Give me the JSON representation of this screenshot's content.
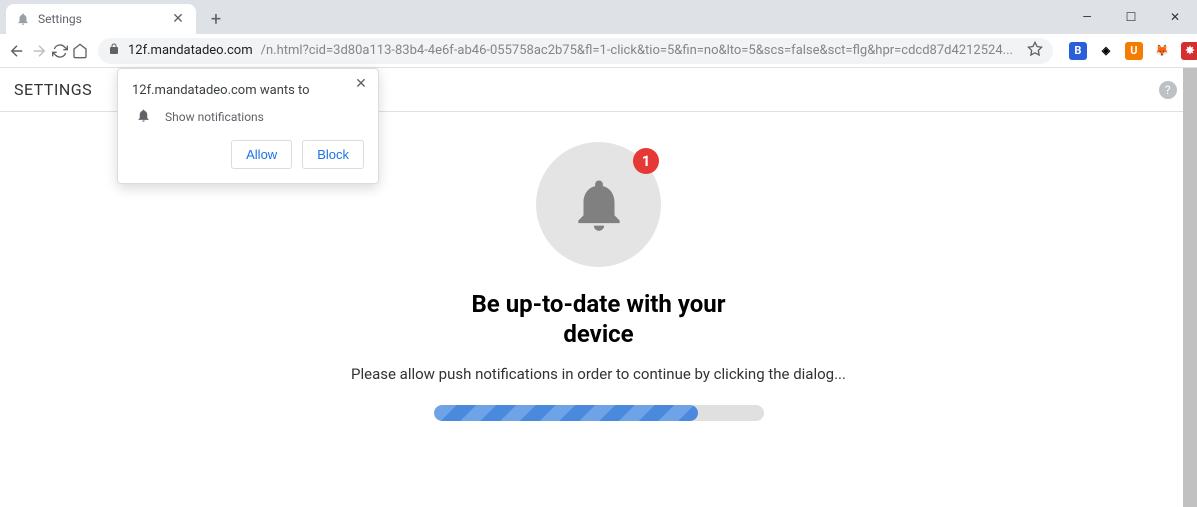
{
  "tab": {
    "title": "Settings"
  },
  "window_controls": {
    "minimize": "—",
    "maximize": "☐",
    "close": "✕"
  },
  "omnibox": {
    "host": "12f.mandatadeo.com",
    "path": "/n.html?cid=3d80a113-83b4-4e6f-ab46-055758ac2b75&fl=1-click&tio=5&fin=no&lto=5&scs=false&sct=flg&hpr=cdcd87d4212524..."
  },
  "extensions": [
    {
      "name": "ext1",
      "bg": "#2b5fd9",
      "glyph": "B"
    },
    {
      "name": "ext2",
      "bg": "#000000",
      "glyph": "◈"
    },
    {
      "name": "ext3",
      "bg": "#f57c00",
      "glyph": "U"
    },
    {
      "name": "ext4",
      "bg": "#ffffff",
      "glyph": "🦊"
    },
    {
      "name": "ext5",
      "bg": "#d32f2f",
      "glyph": "✸"
    },
    {
      "name": "ext6",
      "bg": "#1a237e",
      "glyph": "▦"
    }
  ],
  "page_header": {
    "title": "SETTINGS"
  },
  "permission": {
    "title": "12f.mandatadeo.com wants to",
    "request": "Show notifications",
    "allow": "Allow",
    "block": "Block"
  },
  "main": {
    "badge_count": "1",
    "headline_l1": "Be up-to-date with your",
    "headline_l2": "device",
    "subline": "Please allow push notifications in order to continue by clicking the dialog..."
  }
}
